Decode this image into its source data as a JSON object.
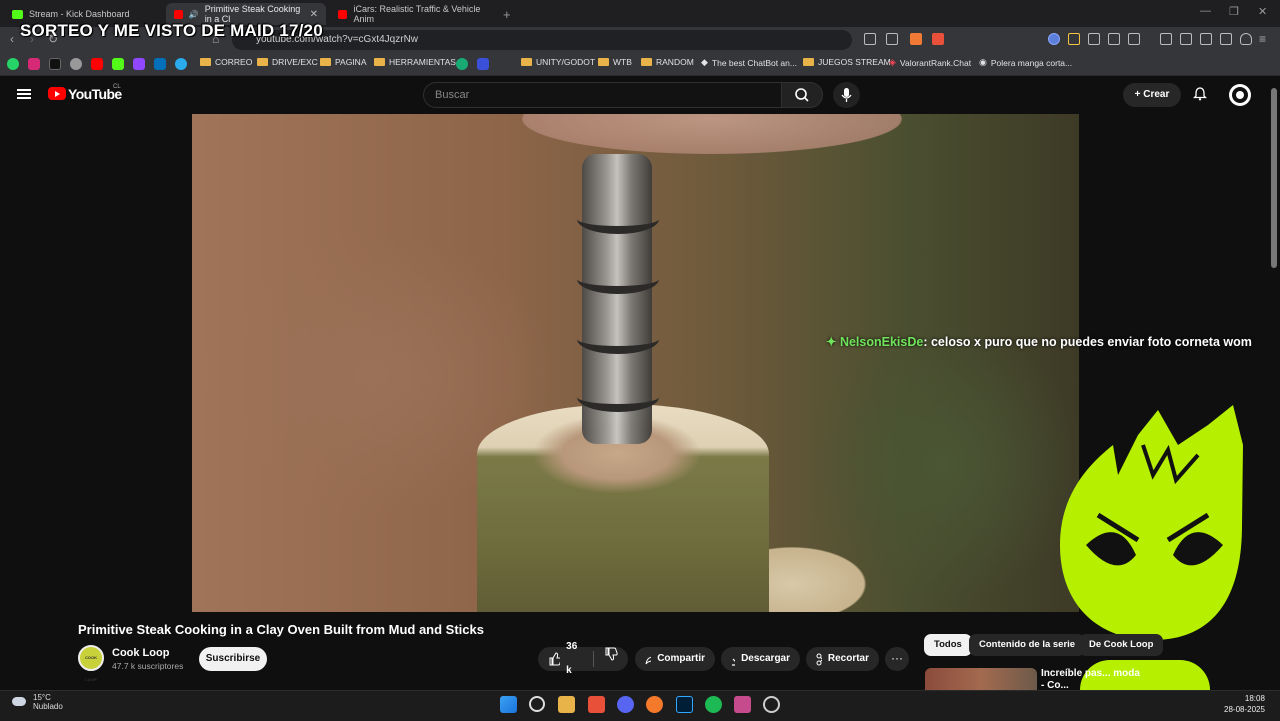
{
  "browser": {
    "tabs": [
      {
        "label": "Stream - Kick Dashboard",
        "color": "#53fc18"
      },
      {
        "label": "Primitive Steak Cooking in a Cl",
        "color": "#ff0000"
      },
      {
        "label": "iCars: Realistic Traffic & Vehicle Anim",
        "color": "#ff0000"
      }
    ],
    "new_tab": "+",
    "url": "youtube.com/watch?v=cGxt4JqzrNw",
    "overlay_title": "SORTEO Y ME VISTO DE MAID 17/20",
    "bookmarks": [
      {
        "label": "CORREO",
        "icon": "folder-icon"
      },
      {
        "label": "DRIVE/EXC",
        "icon": "folder-icon"
      },
      {
        "label": "PAGINA",
        "icon": "folder-icon"
      },
      {
        "label": "HERRAMIENTAS",
        "icon": "folder-icon"
      },
      {
        "label": "UNITY/GODOT",
        "icon": "folder-icon"
      },
      {
        "label": "WTB",
        "icon": "folder-icon"
      },
      {
        "label": "RANDOM",
        "icon": "folder-icon"
      },
      {
        "label": "The best ChatBot an...",
        "icon": "chatbot-icon"
      },
      {
        "label": "JUEGOS STREAM",
        "icon": "folder-icon"
      },
      {
        "label": "ValorantRank.Chat",
        "icon": "valorant-icon"
      },
      {
        "label": "Polera manga corta...",
        "icon": "globe-icon"
      }
    ]
  },
  "youtube": {
    "logo_text": "YouTube",
    "country": "CL",
    "search_placeholder": "Buscar",
    "create_label": "Crear",
    "video_title": "Primitive Steak Cooking in a Clay Oven Built from Mud and Sticks",
    "channel_name": "Cook Loop",
    "channel_avatar_text": "COOK LOOP",
    "subscribers": "47.7 k suscriptores",
    "subscribe_label": "Suscribirse",
    "likes": "36 k",
    "share_label": "Compartir",
    "download_label": "Descargar",
    "clip_label": "Recortar",
    "more_label": "···",
    "chips": [
      "Todos",
      "Contenido de la serie",
      "De Cook Loop"
    ],
    "related_title": "Increíble pas... moda - Co..."
  },
  "overlay": {
    "chat_user": "NelsonEkisDe",
    "chat_message": ": celoso x puro que no puedes enviar foto corneta wom",
    "mascot_color": "#b6f000"
  },
  "taskbar": {
    "temperature": "15°C",
    "weather": "Nublado",
    "time": "18:08",
    "date": "28-08-2025"
  }
}
